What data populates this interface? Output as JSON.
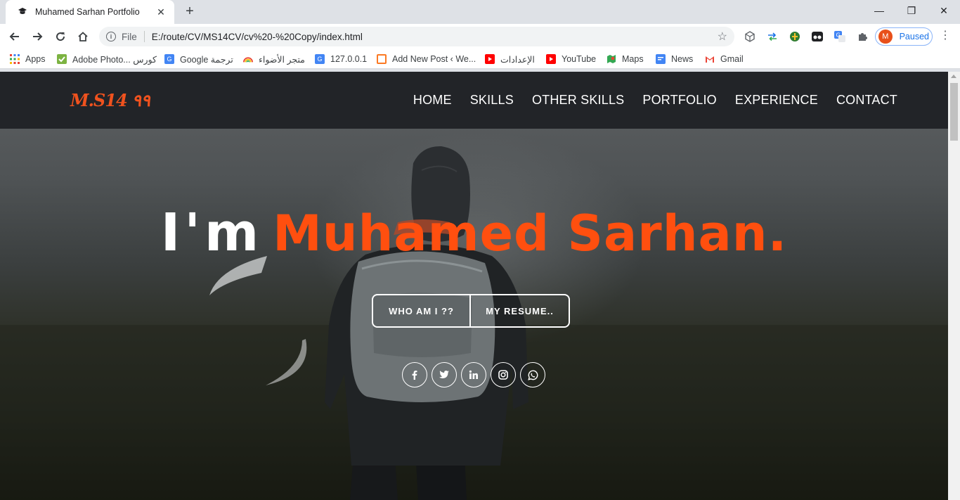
{
  "browser": {
    "tab_title": "Muhamed Sarhan Portfolio",
    "tab_close": "✕",
    "new_tab": "+",
    "scheme": "File",
    "url": "E:/route/CV/MS14CV/cv%20-%20Copy/index.html",
    "profile_initial": "M",
    "profile_status": "Paused",
    "window_controls": {
      "minimize": "—",
      "restore": "❐",
      "close": "✕"
    }
  },
  "bookmarks": [
    {
      "label": "Apps",
      "icon": "apps-grid-icon",
      "color": "#4285f4"
    },
    {
      "label": "Adobe Photo... كورس",
      "icon": "checkbox-icon",
      "color": "#7cb342"
    },
    {
      "label": "Google ترجمة",
      "icon": "google-translate-icon",
      "color": "#4285f4"
    },
    {
      "label": "متجر الأضواء",
      "icon": "rainbow-icon",
      "color": "#f4b400"
    },
    {
      "label": "127.0.0.1",
      "icon": "google-translate-icon",
      "color": "#4285f4"
    },
    {
      "label": "Add New Post ‹ We...",
      "icon": "xampp-icon",
      "color": "#fb7a24"
    },
    {
      "label": "الإعدادات",
      "icon": "youtube-icon",
      "color": "#ff0000"
    },
    {
      "label": "YouTube",
      "icon": "youtube-icon",
      "color": "#ff0000"
    },
    {
      "label": "Maps",
      "icon": "maps-icon",
      "color": "#34a853"
    },
    {
      "label": "News",
      "icon": "news-icon",
      "color": "#4285f4"
    },
    {
      "label": "Gmail",
      "icon": "gmail-icon",
      "color": "#ea4335"
    }
  ],
  "site": {
    "logo": "M.S14 ٩٩",
    "nav": [
      "HOME",
      "SKILLS",
      "OTHER SKILLS",
      "PORTFOLIO",
      "EXPERIENCE",
      "CONTACT"
    ],
    "headline_prefix": "I'm",
    "headline_name": "Muhamed Sarhan.",
    "accent_color": "#ff4f0f",
    "buttons": {
      "about": "WHO AM I ??",
      "resume": "MY RESUME.."
    },
    "socials": [
      "facebook-icon",
      "twitter-icon",
      "linkedin-icon",
      "instagram-icon",
      "whatsapp-icon"
    ]
  }
}
